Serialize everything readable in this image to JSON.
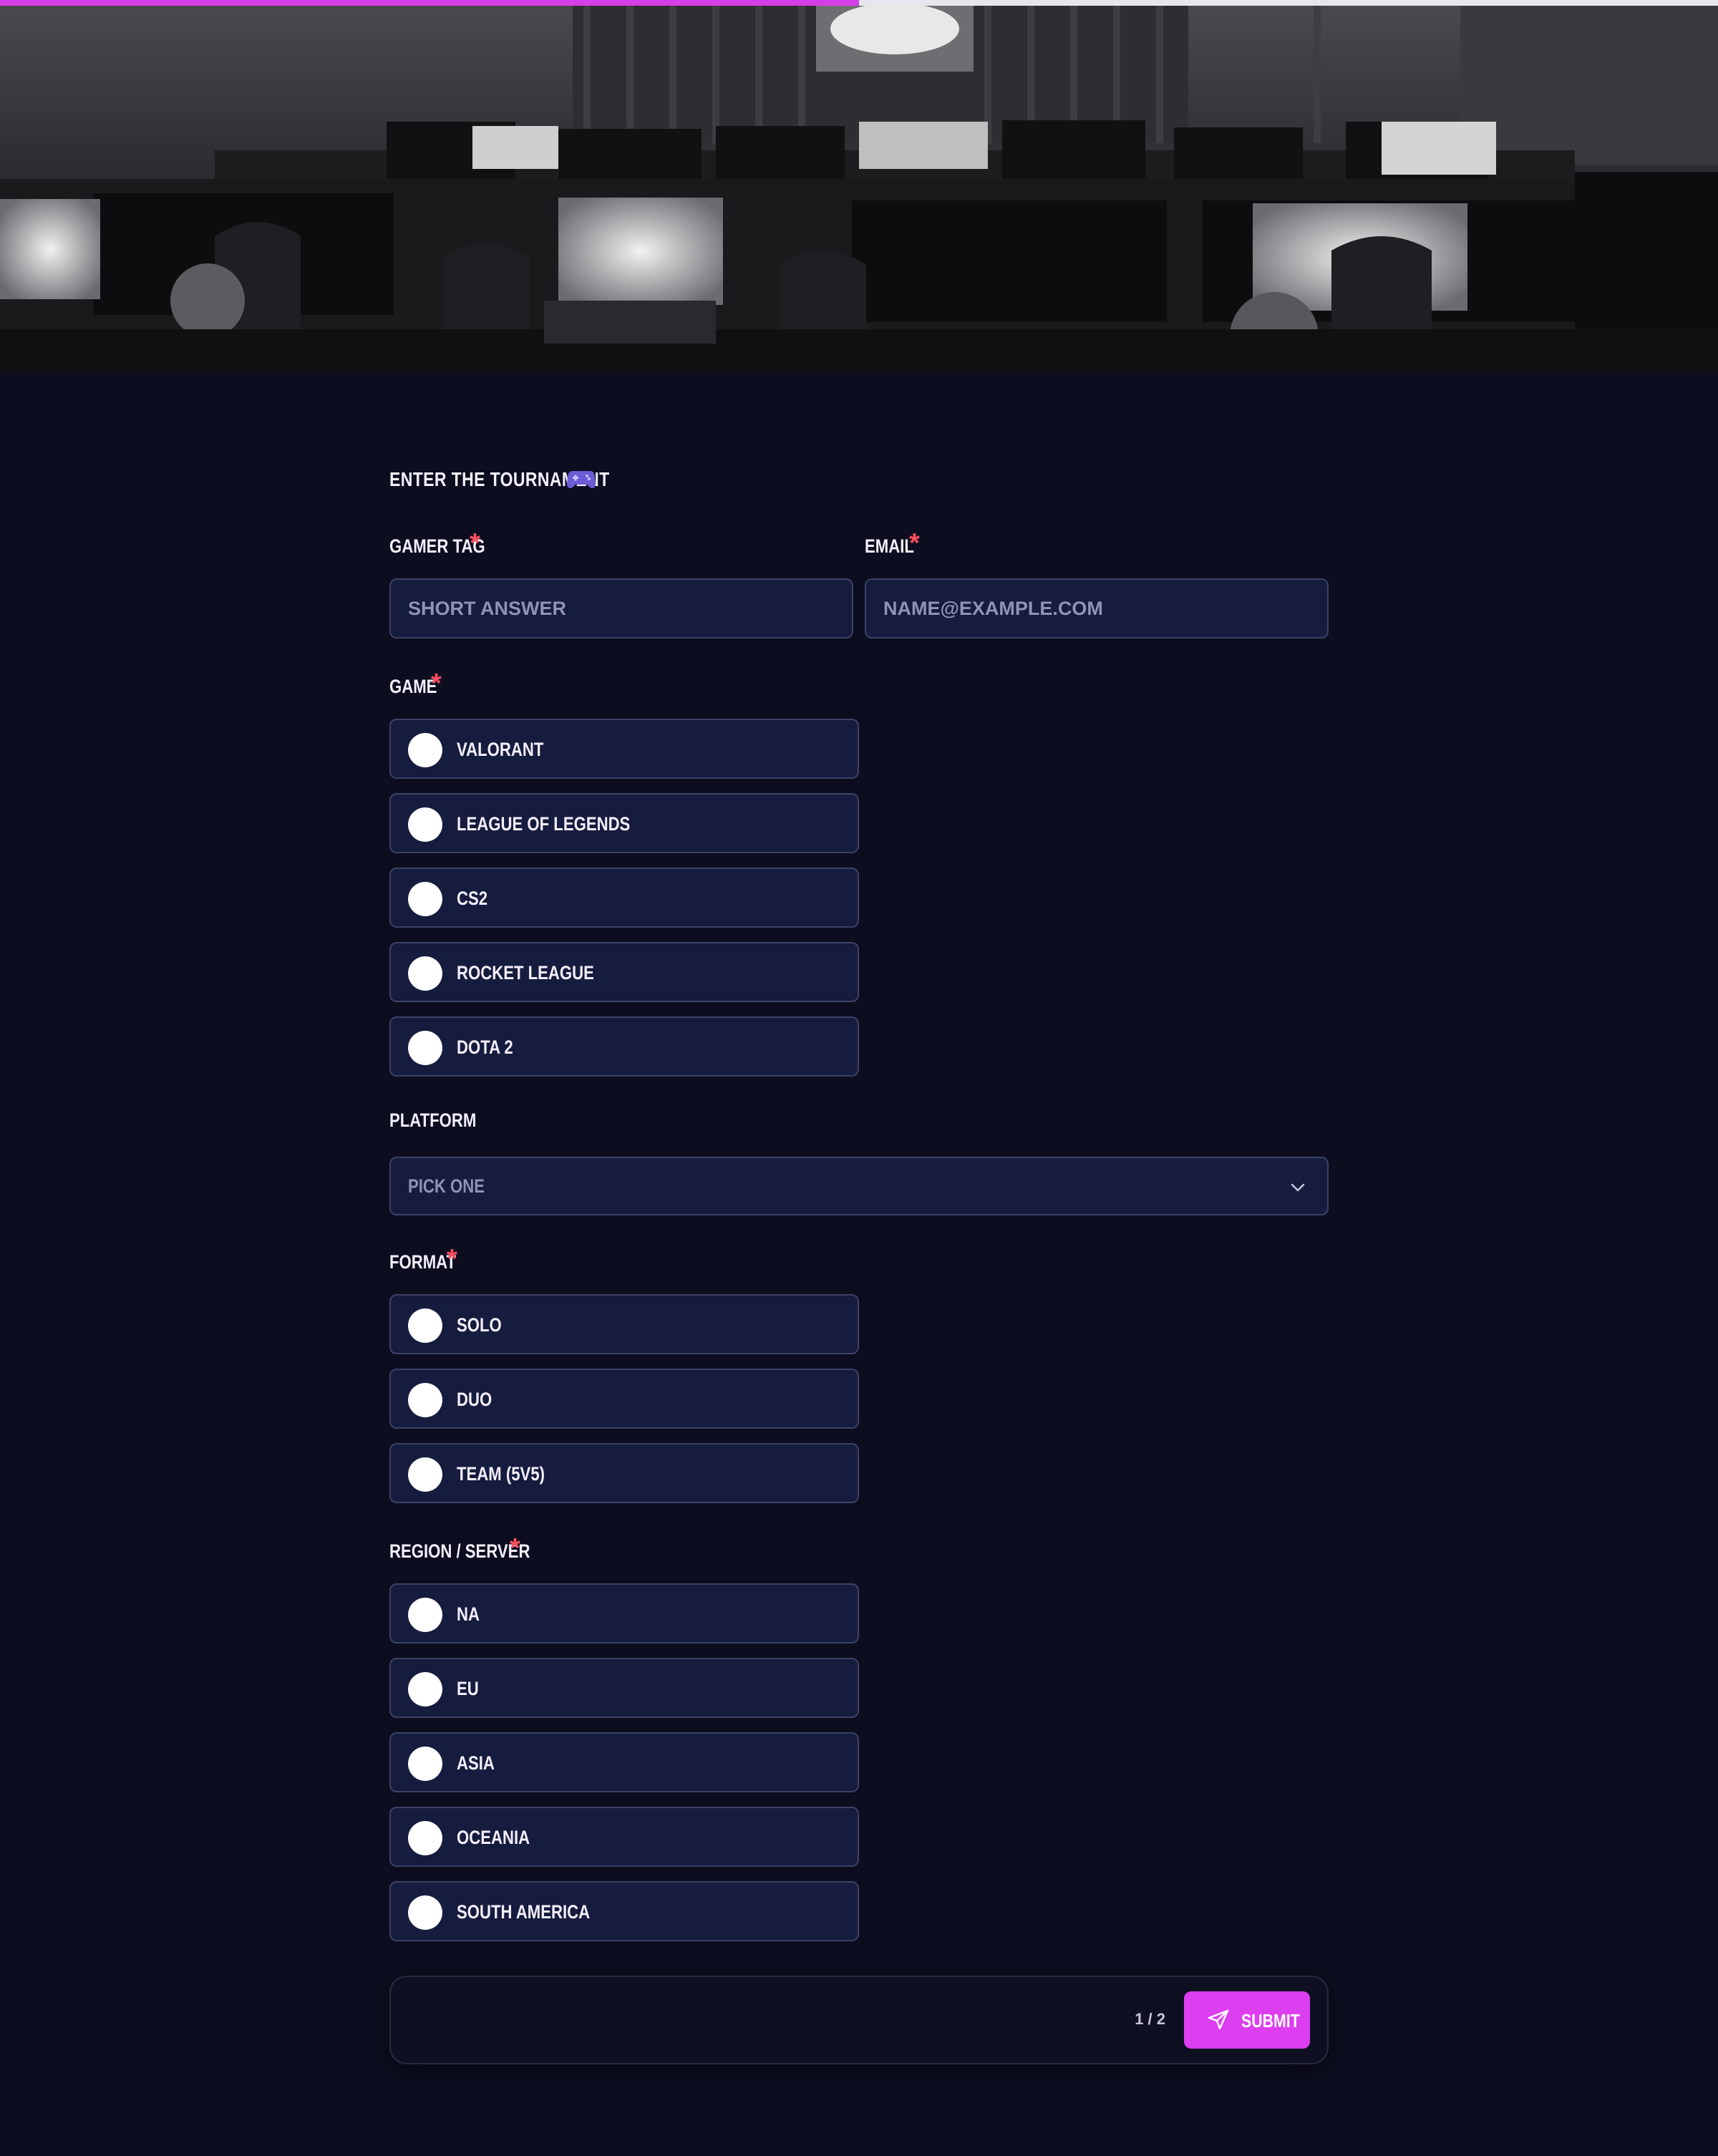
{
  "progress": {
    "fraction": 0.5
  },
  "hero": {
    "image": "grayscale photo of esports gaming arena with players at computer stations"
  },
  "form": {
    "title": "ENTER THE TOURNAMENT",
    "title_icon": "game-controller-icon",
    "fields": {
      "gamer_tag": {
        "label": "GAMER TAG",
        "required": true,
        "placeholder": "SHORT ANSWER",
        "value": ""
      },
      "email": {
        "label": "EMAIL",
        "required": true,
        "placeholder": "NAME@EXAMPLE.COM",
        "value": ""
      },
      "game": {
        "label": "GAME",
        "required": true,
        "options": [
          "VALORANT",
          "LEAGUE OF LEGENDS",
          "CS2",
          "ROCKET LEAGUE",
          "DOTA 2"
        ]
      },
      "platform": {
        "label": "PLATFORM",
        "required": false,
        "value": "PICK ONE"
      },
      "format": {
        "label": "FORMAT",
        "required": true,
        "options": [
          "SOLO",
          "DUO",
          "TEAM (5V5)"
        ]
      },
      "region": {
        "label": "REGION / SERVER",
        "required": true,
        "options": [
          "NA",
          "EU",
          "ASIA",
          "OCEANIA",
          "SOUTH AMERICA"
        ]
      }
    },
    "required_marker": "*",
    "footer": {
      "page_count": "1 / 2",
      "submit_label": "SUBMIT",
      "submit_icon": "send-icon"
    }
  },
  "colors": {
    "background": "#0c0e1f",
    "input_bg": "#161c3d",
    "accent": "#dd3ef0",
    "required": "#ff4d5e"
  }
}
